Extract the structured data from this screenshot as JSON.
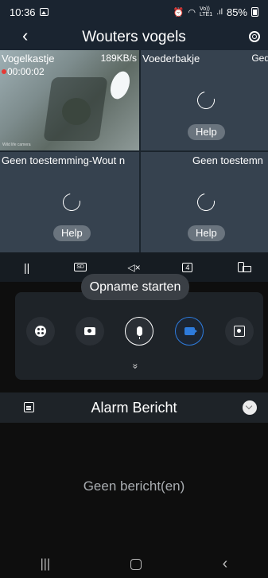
{
  "status_bar": {
    "time": "10:36",
    "network_label_top": "Vo))",
    "network_label_bottom": "LTE1",
    "battery": "85%"
  },
  "header": {
    "title": "Wouters vogels"
  },
  "cameras": [
    {
      "name": "Vogelkastje",
      "rate": "189KB/s",
      "recording_time": "00:00:02",
      "watermark": "Wild life camera",
      "state": "live"
    },
    {
      "name": "Voederbakje",
      "extra": "Ged",
      "state": "loading",
      "help_label": "Help"
    },
    {
      "name": "Geen toestemming-Wout n",
      "state": "loading",
      "help_label": "Help"
    },
    {
      "name": "Geen toestemn",
      "state": "loading",
      "help_label": "Help"
    }
  ],
  "controls": {
    "pause_icon": "pause-icon",
    "sd_label": "SD",
    "mute_icon": "speaker-muted-icon",
    "split_label": "4",
    "rotate_icon": "rotate-screen-icon"
  },
  "tooltip": {
    "text": "Opname starten"
  },
  "actions": [
    {
      "icon": "ptz-icon"
    },
    {
      "icon": "snapshot-camera-icon"
    },
    {
      "icon": "microphone-icon"
    },
    {
      "icon": "record-video-icon",
      "active": true
    },
    {
      "icon": "screenshot-icon"
    }
  ],
  "expand_label": "»",
  "alarm": {
    "title": "Alarm Bericht",
    "empty_text": "Geen bericht(en)"
  },
  "navbar": {
    "recents": "|||",
    "back": "‹"
  },
  "colors": {
    "accent": "#2e7bdc",
    "header_bg": "#1a2430",
    "tile_bg": "#36424f",
    "rec_dot": "#e53935"
  }
}
